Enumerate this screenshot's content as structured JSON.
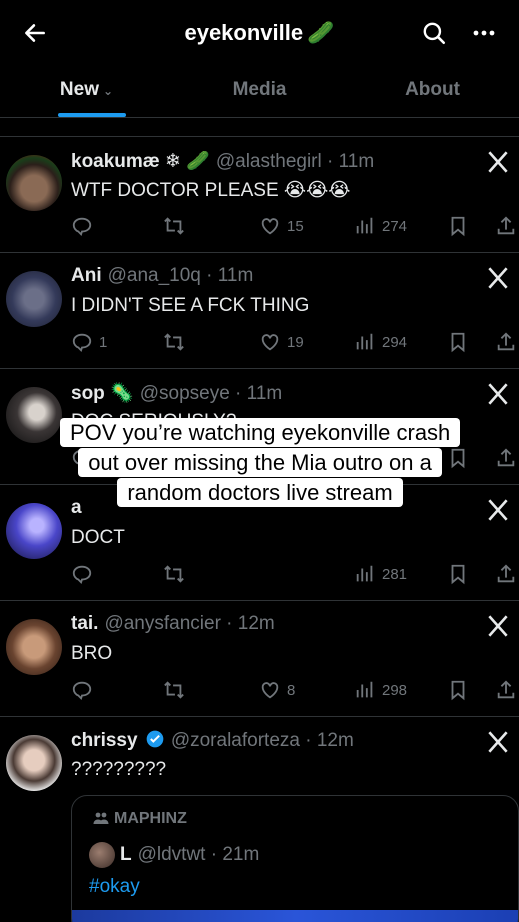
{
  "header": {
    "title": "eyekonville",
    "title_emoji": "🥒"
  },
  "tabs": [
    {
      "label": "New"
    },
    {
      "label": "Media"
    },
    {
      "label": "About"
    }
  ],
  "tweets": [
    {
      "name": "koakumæ ❄ 🥒",
      "handle": "@alasthegirl · 11m",
      "text": "WTF DOCTOR PLEASE 😭😭😭",
      "likes": "15",
      "views": "274"
    },
    {
      "name": "Ani",
      "handle": "@ana_10q · 11m",
      "text": "I DIDN'T SEE A FCK THING",
      "replies": "1",
      "likes": "19",
      "views": "294"
    },
    {
      "name": "sop 🦠",
      "handle": "@sopseye · 11m",
      "text": "DOC SERIOUSLY?",
      "views_partial": "8"
    },
    {
      "name": "a",
      "text": "DOCT",
      "views": "281"
    },
    {
      "name": "tai.",
      "handle": "@anysfancier · 12m",
      "text": "BRO",
      "likes": "8",
      "views": "298"
    },
    {
      "name": "chrissy",
      "handle": "@zoralaforteza · 12m",
      "text": "?????????",
      "quote": {
        "community": "MAPHINZ",
        "name": "L",
        "handle": "@ldvtwt · 21m",
        "hashtag": "#okay"
      }
    }
  ],
  "caption": "POV you’re watching eyekonville crash out over missing the Mia outro on a random doctors live stream",
  "colors": {
    "accent": "#1d9bf0",
    "muted": "#71767b",
    "divider": "#2f3336",
    "verified": "#1d9bf0"
  }
}
